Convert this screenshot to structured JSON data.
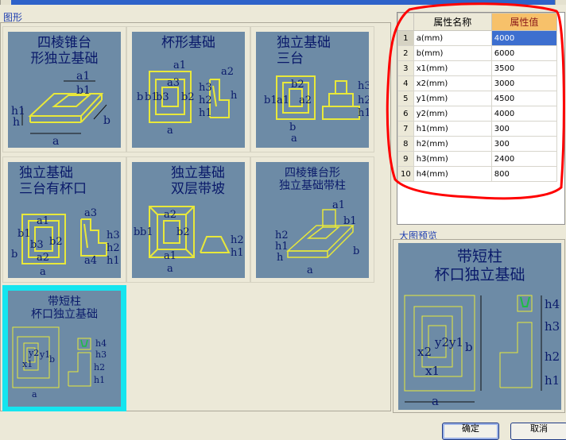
{
  "window": {
    "accent": "#2e62c9"
  },
  "gallery": {
    "label": "图形",
    "tiles": [
      {
        "title": [
          "四棱锥台",
          "形独立基础"
        ],
        "dims": [
          "a1",
          "b1",
          "h1",
          "h",
          "a",
          "b"
        ],
        "selected": false
      },
      {
        "title": [
          "杯形基础"
        ],
        "dims": [
          "a1",
          "a2",
          "a3",
          "b",
          "b1",
          "b3",
          "b2",
          "h3",
          "h2",
          "h1",
          "h",
          "a"
        ],
        "selected": false
      },
      {
        "title": [
          "独立基础",
          "三台"
        ],
        "dims": [
          "b2",
          "a2",
          "a1",
          "b1",
          "b",
          "a",
          "h3",
          "h2",
          "h1"
        ],
        "selected": false
      },
      {
        "title": [
          "独立基础",
          "三台有杯口"
        ],
        "dims": [
          "a1",
          "a3",
          "b1",
          "b3",
          "b2",
          "a2",
          "a4",
          "h3",
          "h2",
          "h1",
          "a",
          "b"
        ],
        "selected": false
      },
      {
        "title": [
          "独立基础",
          "双层带坡"
        ],
        "dims": [
          "a2",
          "b1",
          "b2",
          "a1",
          "h2",
          "h1",
          "a",
          "b"
        ],
        "selected": false
      },
      {
        "title": [
          "四棱锥台形",
          "独立基础带柱"
        ],
        "dims": [
          "a1",
          "b1",
          "h2",
          "h1",
          "h",
          "a",
          "b"
        ],
        "selected": false
      },
      {
        "title": [
          "带短柱",
          "杯口独立基础"
        ],
        "dims": [
          "x1",
          "y2",
          "y1",
          "b",
          "a",
          "h4",
          "h3",
          "h2",
          "h1"
        ],
        "selected": true
      }
    ]
  },
  "properties": {
    "header": {
      "name": "属性名称",
      "value": "属性值"
    },
    "rows": [
      {
        "index": "1",
        "name": "a(mm)",
        "value": "4000",
        "selected": true
      },
      {
        "index": "2",
        "name": "b(mm)",
        "value": "6000"
      },
      {
        "index": "3",
        "name": "x1(mm)",
        "value": "3500"
      },
      {
        "index": "4",
        "name": "x2(mm)",
        "value": "3000"
      },
      {
        "index": "5",
        "name": "y1(mm)",
        "value": "4500"
      },
      {
        "index": "6",
        "name": "y2(mm)",
        "value": "4000"
      },
      {
        "index": "7",
        "name": "h1(mm)",
        "value": "300"
      },
      {
        "index": "8",
        "name": "h2(mm)",
        "value": "300"
      },
      {
        "index": "9",
        "name": "h3(mm)",
        "value": "2400"
      },
      {
        "index": "10",
        "name": "h4(mm)",
        "value": "800"
      }
    ]
  },
  "preview": {
    "label": "大图预览",
    "title": [
      "带短柱",
      "杯口独立基础"
    ],
    "dims": [
      "y2",
      "y1",
      "b",
      "x2",
      "x1",
      "a",
      "h4",
      "h3",
      "h2",
      "h1"
    ]
  },
  "buttons": {
    "ok": "确定",
    "cancel": "取消"
  },
  "colors": {
    "drawing_bg": "#6d8ba6",
    "drawing_line": "#e8e83a",
    "selected_frame": "#15e5ef",
    "value_header": "#f7c16a",
    "annotation": "#ff0000"
  }
}
